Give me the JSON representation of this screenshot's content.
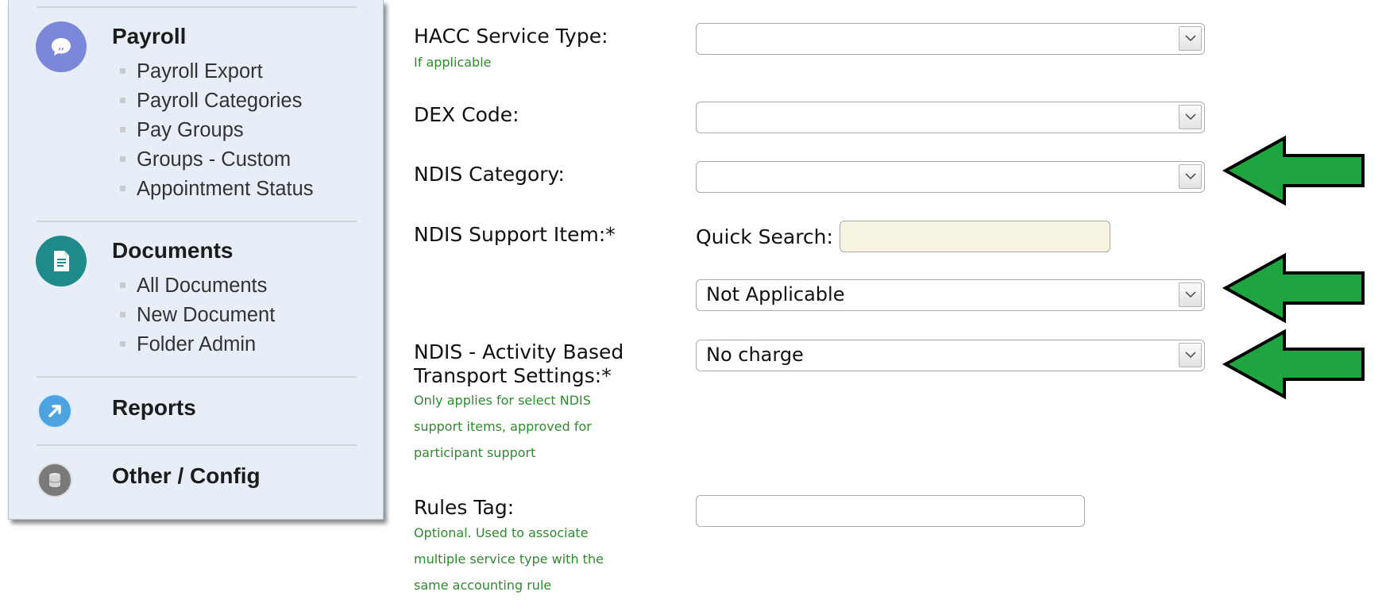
{
  "sidebar": {
    "payroll": {
      "title": "Payroll",
      "icon": "speech-bubble-icon",
      "icon_color": "#7b87d8",
      "items": [
        "Payroll Export",
        "Payroll Categories",
        "Pay Groups",
        "Groups - Custom",
        "Appointment Status"
      ]
    },
    "documents": {
      "title": "Documents",
      "icon": "document-icon",
      "icon_color": "#1f8a8a",
      "items": [
        "All Documents",
        "New Document",
        "Folder Admin"
      ]
    },
    "reports": {
      "title": "Reports",
      "icon": "arrow-link-icon",
      "icon_color": "#4da3e0"
    },
    "other_config": {
      "title": "Other / Config",
      "icon": "database-icon",
      "icon_color": "#7a7a7a"
    }
  },
  "form": {
    "hacc_service_type": {
      "label": "HACC Service Type:",
      "hint": "If applicable",
      "value": ""
    },
    "dex_code": {
      "label": "DEX Code:",
      "value": ""
    },
    "ndis_category": {
      "label": "NDIS Category:",
      "value": ""
    },
    "ndis_support_item": {
      "label": "NDIS Support Item:*",
      "quick_search_label": "Quick Search:",
      "quick_search_value": "",
      "value": "Not Applicable"
    },
    "ndis_transport": {
      "label_line1": "NDIS - Activity Based",
      "label_line2": "Transport Settings:*",
      "hint_lines": [
        "Only applies for select NDIS",
        "support items, approved for",
        "participant support"
      ],
      "value": "No charge"
    },
    "rules_tag": {
      "label": "Rules Tag:",
      "hint_lines": [
        "Optional. Used to associate",
        "multiple service type with the",
        "same accounting rule"
      ],
      "value": ""
    }
  },
  "colors": {
    "sidebar_bg": "#e7eef8",
    "hint_green": "#2e8a2e",
    "arrow_green": "#1fa53f",
    "search_bg": "#f7f3e2"
  }
}
